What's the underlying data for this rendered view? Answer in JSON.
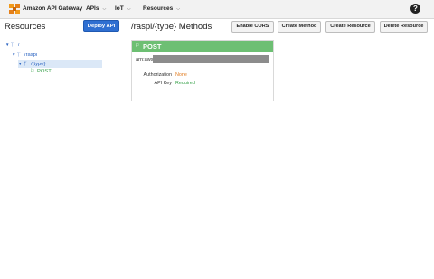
{
  "topbar": {
    "brand": "Amazon API Gateway",
    "nav": [
      {
        "label": "APIs"
      },
      {
        "label": "IoT"
      },
      {
        "label": "Resources"
      }
    ],
    "help": "?"
  },
  "sidebar": {
    "title": "Resources",
    "deploy_label": "Deploy API",
    "tree": [
      {
        "label": "/"
      },
      {
        "label": "/raspi"
      },
      {
        "label": "/{type}"
      },
      {
        "label": "POST"
      }
    ]
  },
  "main": {
    "title": "/raspi/{type} Methods",
    "buttons": {
      "enable_cors": "Enable CORS",
      "create_method": "Create Method",
      "create_resource": "Create Resource",
      "delete_resource": "Delete Resource"
    },
    "method_card": {
      "title": "POST",
      "arn_label": "arn:aws",
      "authorization_label": "Authorization",
      "authorization_value": "None",
      "api_key_label": "API Key",
      "api_key_value": "Required"
    }
  },
  "colors": {
    "accent_blue": "#2f6fd1",
    "method_green": "#6dbf73",
    "none_orange": "#e07b1f",
    "required_green": "#38a14a"
  }
}
